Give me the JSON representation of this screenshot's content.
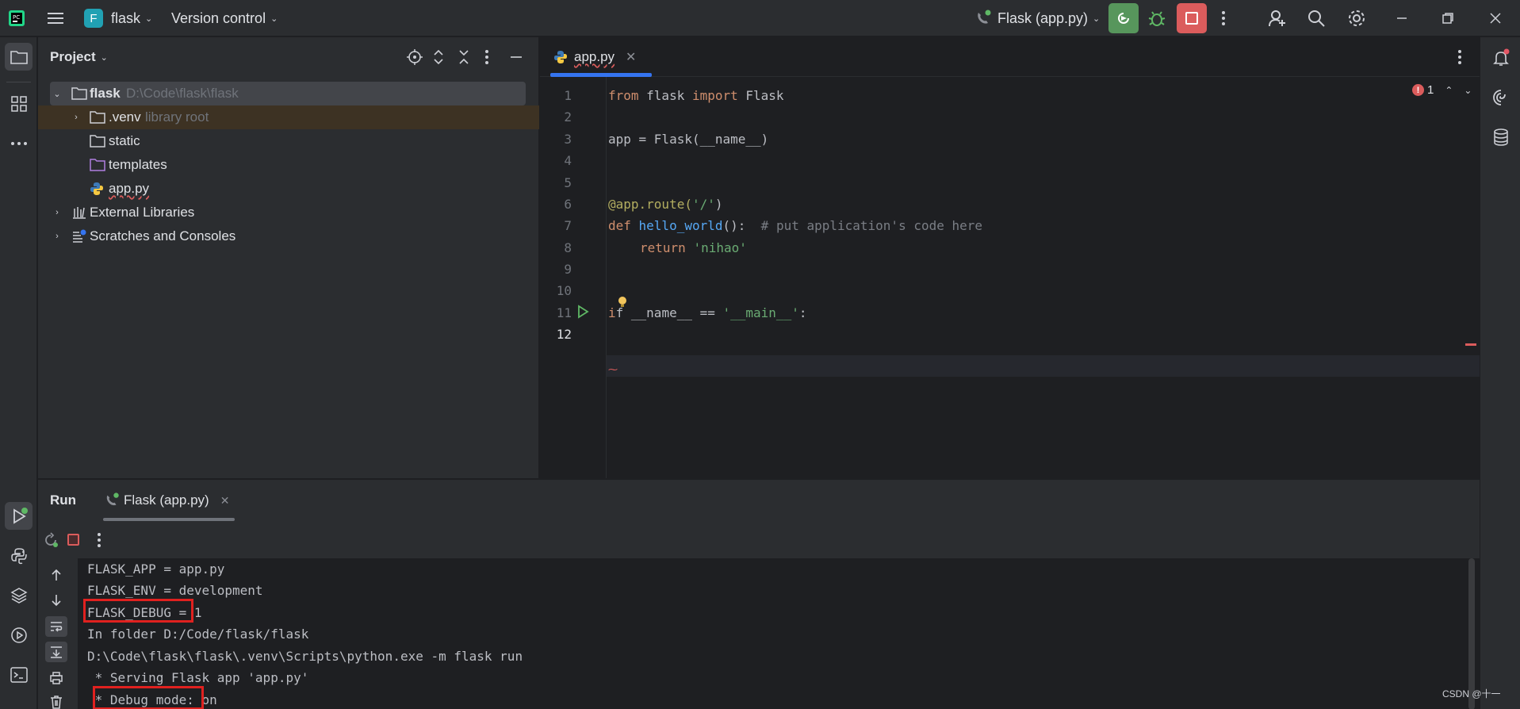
{
  "titlebar": {
    "project_initial": "F",
    "project_name": "flask",
    "vcs_label": "Version control",
    "run_config": "Flask (app.py)"
  },
  "colors": {
    "accent": "#3574f0",
    "run_green": "#57965c",
    "stop_red": "#db5c5c",
    "highlight_red": "#e0211f",
    "project_badge": "#21a1b3"
  },
  "project_panel": {
    "title": "Project",
    "tree": [
      {
        "name": "flask",
        "hint": "D:\\Code\\flask\\flask",
        "kind": "folder",
        "expanded": true
      },
      {
        "name": ".venv",
        "hint": "library root",
        "kind": "folder",
        "expanded": false
      },
      {
        "name": "static",
        "hint": "",
        "kind": "folder"
      },
      {
        "name": "templates",
        "hint": "",
        "kind": "folder-purple"
      },
      {
        "name": "app.py",
        "hint": "",
        "kind": "python"
      },
      {
        "name": "External Libraries",
        "hint": "",
        "kind": "library"
      },
      {
        "name": "Scratches and Consoles",
        "hint": "",
        "kind": "scratches"
      }
    ]
  },
  "editor": {
    "tab_label": "app.py",
    "problems_count": "1",
    "line_numbers": [
      "1",
      "2",
      "3",
      "4",
      "5",
      "6",
      "7",
      "8",
      "9",
      "10",
      "11",
      "12"
    ],
    "lines": {
      "l1_kw1": "from",
      "l1_mod": " flask ",
      "l1_kw2": "import",
      "l1_name": " Flask",
      "l3": "app = Flask(__name__)",
      "l6_dec": "@app.route(",
      "l6_str": "'/'",
      "l6_close": ")",
      "l7_kw": "def ",
      "l7_fn": "hello_world",
      "l7_rest": "():  ",
      "l7_comment": "# put application's code here",
      "l8_kw": "return ",
      "l8_str": "'nihao'",
      "l11_kw": "i",
      "l11_rest": "f __name__ == ",
      "l11_str": "'__main__'",
      "l11_colon": ":"
    }
  },
  "run_panel": {
    "title": "Run",
    "tab_label": "Flask (app.py)",
    "console_lines": [
      "FLASK_APP = app.py",
      "FLASK_ENV = development",
      "FLASK_DEBUG = 1",
      "In folder D:/Code/flask/flask",
      "D:\\Code\\flask\\flask\\.venv\\Scripts\\python.exe -m flask run",
      " * Serving Flask app 'app.py'",
      " * Debug mode: on"
    ]
  },
  "watermark": "CSDN @十一"
}
